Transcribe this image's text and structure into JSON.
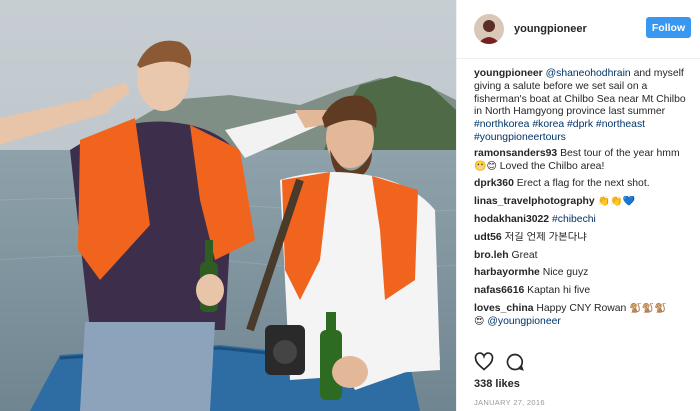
{
  "header": {
    "username": "youngpioneer",
    "follow_label": "Follow"
  },
  "caption": {
    "username": "youngpioneer",
    "mention": "@shaneohodhrain",
    "text": "and myself giving a salute before we set sail on a fisherman's boat at Chilbo Sea near Mt Chilbo in North Hamgyong province last summer",
    "hashtags": [
      "#northkorea",
      "#korea",
      "#dprk",
      "#northeast",
      "#youngpioneertours"
    ]
  },
  "comments": [
    {
      "username": "ramonsanders93",
      "text": "Best tour of the year hmm",
      "text2": "Loved the Chilbo area!"
    },
    {
      "username": "dprk360",
      "text": "Erect a flag for the next shot."
    },
    {
      "username": "linas_travelphotography",
      "text": ""
    },
    {
      "username": "hodakhani3022",
      "hashtag": "#chibechi"
    },
    {
      "username": "udt56",
      "text": "저길 언제 가본다냐"
    },
    {
      "username": "bro.leh",
      "text": "Great"
    },
    {
      "username": "harbayormhe",
      "text": "Nice guyz"
    },
    {
      "username": "nafas6616",
      "text": "Kaptan hi five"
    },
    {
      "username": "loves_china",
      "text": "Happy CNY Rowan",
      "mention": "@youngpioneer"
    }
  ],
  "actions": {
    "like_icon": "heart-icon",
    "comment_icon": "comment-icon"
  },
  "likes": "338 likes",
  "date": "JANUARY 27, 2016",
  "colors": {
    "accent": "#3897f0",
    "link": "#003569",
    "lifejacket": "#f0641e"
  }
}
